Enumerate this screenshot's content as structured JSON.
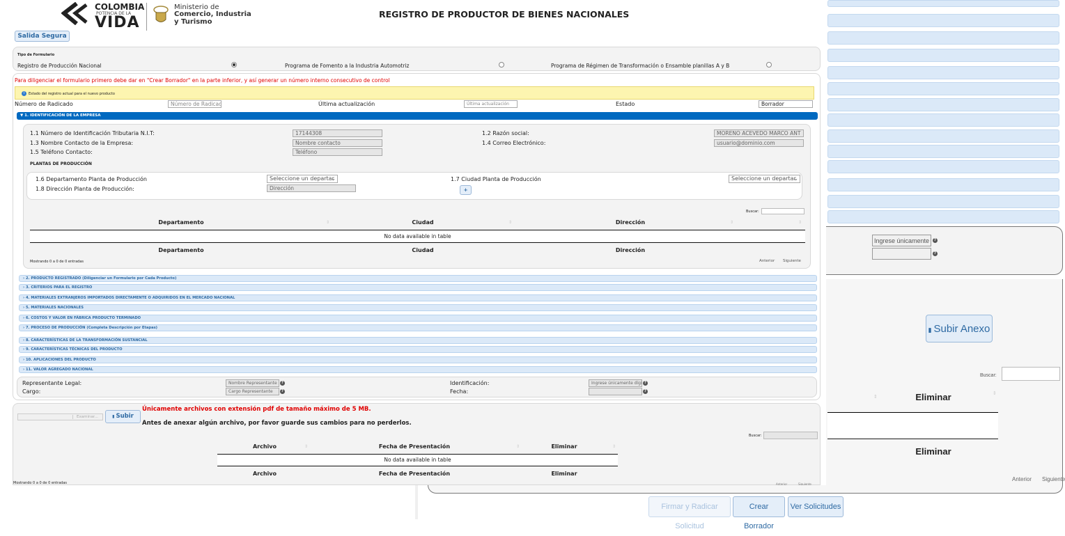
{
  "header": {
    "logo_line1": "COLOMBIA",
    "logo_line2": "POTENCIA DE LA",
    "logo_line3": "VIDA",
    "ministry_line1": "Ministerio de",
    "ministry_line2": "Comercio, Industria",
    "ministry_line3": "y Turismo",
    "title": "REGISTRO DE PRODUCTOR DE BIENES NACIONALES",
    "logout": "Salida Segura"
  },
  "form_type": {
    "label": "Tipo de Formulario",
    "options": [
      "Registro de Producción Nacional",
      "Programa de Fomento a la Industria Automotriz",
      "Programa de Régimen de Transformación o Ensamble planillas A y B"
    ],
    "selected": 0
  },
  "warning": "Para diligenciar el formulario primero debe dar en \"Crear Borrador\" en la parte inferior, y así generar un número interno consecutivo de control",
  "status": {
    "info": "Estado del registro actual para el nuevo producto",
    "radicado_label": "Número de Radicado",
    "radicado_placeholder": "Número de Radicado",
    "update_label": "Última actualización",
    "update_placeholder": "Última actualización",
    "estado_label": "Estado",
    "estado_value": "Borrador"
  },
  "sec1": {
    "header": "▼ 1. IDENTIFICACIÓN DE LA EMPRESA",
    "nit_label": "1.1 Número de Identificación Tributaria N.I.T:",
    "nit": "17144308",
    "razon_label": "1.2 Razón social:",
    "razon": "MORENO ACEVEDO MARCO ANT",
    "contacto_label": "1.3 Nombre Contacto de la Empresa:",
    "contacto": "Nombre contacto",
    "correo_label": "1.4 Correo Electrónico:",
    "correo": "usuario@dominio.com",
    "tel_label": "1.5 Teléfono Contacto:",
    "tel": "Teléfono",
    "plantas": "PLANTAS DE PRODUCCIÓN",
    "depto_label": "1.6 Departamento Planta de Producción",
    "depto_select": "Seleccione un departar",
    "ciudad_label": "1.7 Ciudad Planta de Producción",
    "ciudad_select": "Seleccione un departar",
    "dir_label": "1.8 Dirección Planta de Producción:",
    "dir": "Dirección",
    "add": "+",
    "search": "Buscar:",
    "cols": [
      "Departamento",
      "Ciudad",
      "Dirección"
    ],
    "empty": "No data available in table",
    "info": "Mostrando 0 a 0 de 0 entradas",
    "prev": "Anterior",
    "next": "Siguiente"
  },
  "sections": [
    "› 2. PRODUCTO REGISTRADO (Diligenciar un Formulario por Cada Producto)",
    "› 3. CRITERIOS PARA EL REGISTRO",
    "› 4. MATERIALES EXTRANJEROS IMPORTADOS DIRECTAMENTE O ADQUIRIDOS EN EL MERCADO NACIONAL",
    "› 5. MATERIALES NACIONALES",
    "› 6. COSTOS Y VALOR EN FÁBRICA PRODUCTO TERMINADO",
    "› 7. PROCESO DE PRODUCCIÓN (Completa Descripción por Etapas)",
    "› 8. CARACTERÍSTICAS DE LA TRANSFORMACIÓN SUSTANCIAL",
    "› 9. CARACTERÍSTICAS TÉCNICAS DEL PRODUCTO",
    "› 10. APLICACIONES DEL PRODUCTO",
    "› 11. VALOR AGREGADO NACIONAL"
  ],
  "legal": {
    "rep_label": "Representante Legal:",
    "rep": "Nombre Representante",
    "cargo_label": "Cargo:",
    "cargo": "Cargo Representante",
    "id_label": "Identificación:",
    "id": "Ingrese únicamente dígit",
    "fecha_label": "Fecha:"
  },
  "upload": {
    "browse": "Examinar...",
    "submit": "Subir",
    "warn": "Únicamente archivos con extensión pdf de tamaño máximo de 5 MB.",
    "note": "Antes de anexar algún archivo, por favor guarde sus cambios para no perderlos.",
    "search": "Buscar:",
    "cols": [
      "Archivo",
      "Fecha de Presentación",
      "Eliminar"
    ],
    "empty": "No data available in table",
    "info": "Mostrando 0 a 0 de 0 entradas",
    "prev": "Anterior",
    "next": "Siguiente"
  },
  "right": {
    "digits": "Ingrese únicamente dígitos",
    "annex": "Subir Anexo",
    "search": "Buscar:",
    "col": "Eliminar",
    "prev": "Anterior",
    "next": "Siguiente"
  },
  "buttons": {
    "sign": "Firmar y Radicar Solicitud",
    "draft": "Crear Borrador",
    "view": "Ver Solicitudes"
  },
  "colors": {
    "accent": "#0069c0",
    "warning": "#e00000",
    "info_bg": "#fdf5b0"
  }
}
